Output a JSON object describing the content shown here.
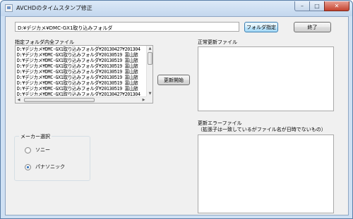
{
  "window": {
    "title": "AVCHDのタイムスタンプ修正",
    "controls": {
      "minimize": "–",
      "maximize": "□",
      "close": "✕"
    }
  },
  "folder": {
    "path_value": "D:¥デジカメ¥DMC-GX1取り込みフォルダ",
    "select_button": "フォルダ指定",
    "exit_button": "終了"
  },
  "files": {
    "label": "指定フォルダ内全ファイル",
    "rows": [
      "D:¥デジカメ¥DMC-GX1取り込みフォルダ¥20130427¥201304",
      "D:¥デジカメ¥DMC-GX1取り込みフォルダ¥20130519 富山旅",
      "D:¥デジカメ¥DMC-GX1取り込みフォルダ¥20130519 富山旅",
      "D:¥デジカメ¥DMC-GX1取り込みフォルダ¥20130519 富山旅",
      "D:¥デジカメ¥DMC-GX1取り込みフォルダ¥20130519 富山旅",
      "D:¥デジカメ¥DMC-GX1取り込みフォルダ¥20130519 富山旅",
      "D:¥デジカメ¥DMC-GX1取り込みフォルダ¥20130519 富山旅",
      "D:¥デジカメ¥DMC-GX1取り込みフォルダ¥20130519 富山旅",
      "D:¥デジカメ¥DMC-GX1取り込みフォルダ¥20130427¥201304"
    ]
  },
  "update_button": "更新開始",
  "normal_files": {
    "label": "正常更新ファイル"
  },
  "error_files": {
    "label": "更新エラーファイル",
    "note": "（拡張子は一致しているがファイル名が日時でないもの）"
  },
  "maker": {
    "title": "メーカー選択",
    "options": [
      {
        "label": "ソニー",
        "checked": false
      },
      {
        "label": "パナソニック",
        "checked": true
      }
    ]
  }
}
